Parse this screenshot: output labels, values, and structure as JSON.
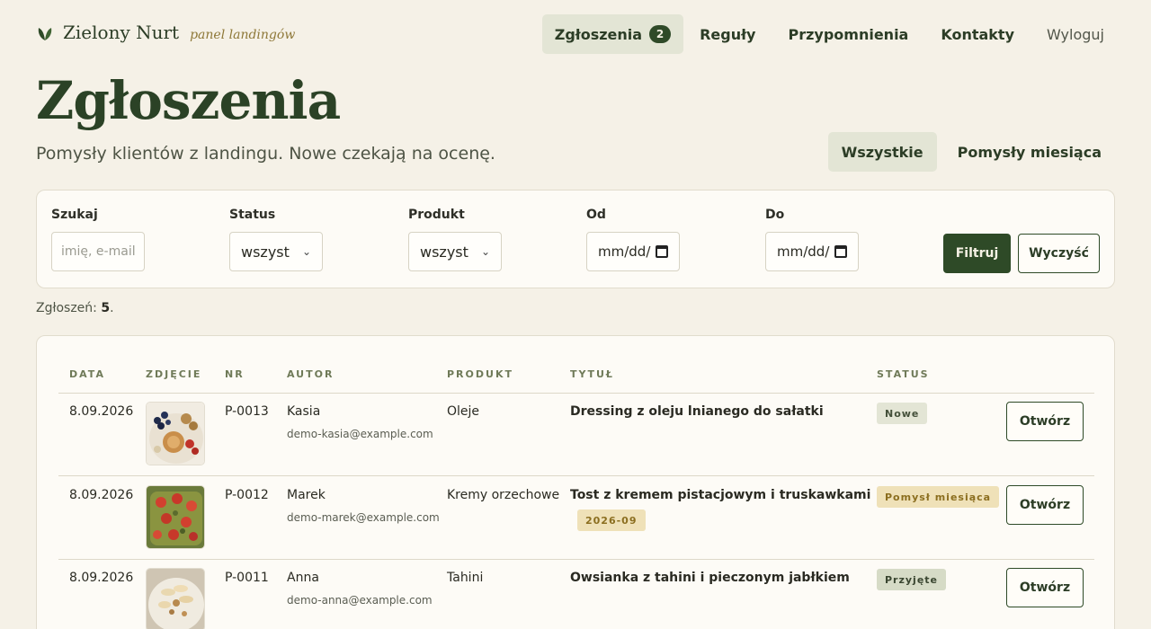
{
  "brand": {
    "name": "Zielony Nurt",
    "subtitle": "panel landingów",
    "icon": "leaf-icon"
  },
  "nav": {
    "items": [
      {
        "label": "Zgłoszenia",
        "badge": "2",
        "active": true
      },
      {
        "label": "Reguły"
      },
      {
        "label": "Przypomnienia"
      },
      {
        "label": "Kontakty"
      },
      {
        "label": "Wyloguj"
      }
    ]
  },
  "header": {
    "title": "Zgłoszenia",
    "subtitle": "Pomysły klientów z landingu. Nowe czekają na ocenę."
  },
  "view_tabs": [
    {
      "label": "Wszystkie",
      "active": true
    },
    {
      "label": "Pomysły miesiąca"
    }
  ],
  "filters": {
    "search": {
      "label": "Szukaj",
      "placeholder": "imię, e-mail"
    },
    "status": {
      "label": "Status",
      "value": "wszyst"
    },
    "product": {
      "label": "Produkt",
      "value": "wszyst"
    },
    "from": {
      "label": "Od",
      "value": "mm/dd/"
    },
    "to": {
      "label": "Do",
      "value": "mm/dd/"
    },
    "submit_label": "Filtruj",
    "clear_label": "Wyczyść"
  },
  "count": {
    "label": "Zgłoszeń:",
    "value": "5"
  },
  "table": {
    "headers": [
      "DATA",
      "ZDJĘCIE",
      "NR",
      "AUTOR",
      "PRODUKT",
      "TYTUŁ",
      "STATUS"
    ],
    "open_label": "Otwórz",
    "rows": [
      {
        "date": "8.09.2026",
        "nr": "P-0013",
        "author": "Kasia",
        "email": "demo-kasia@example.com",
        "product": "Oleje",
        "title": "Dressing z oleju lnianego do sałatki",
        "status": "Nowe"
      },
      {
        "date": "8.09.2026",
        "nr": "P-0012",
        "author": "Marek",
        "email": "demo-marek@example.com",
        "product": "Kremy orzechowe",
        "title": "Tost z kremem pistacjowym i truskawkami",
        "month": "2026-09",
        "status": "Pomysł miesiąca"
      },
      {
        "date": "8.09.2026",
        "nr": "P-0011",
        "author": "Anna",
        "email": "demo-anna@example.com",
        "product": "Tahini",
        "title": "Owsianka z tahini i pieczonym jabłkiem",
        "status": "Przyjęte"
      }
    ]
  },
  "colors": {
    "accent": "#2e4a27",
    "background": "#f5f1e7",
    "gold": "#8e7838"
  }
}
